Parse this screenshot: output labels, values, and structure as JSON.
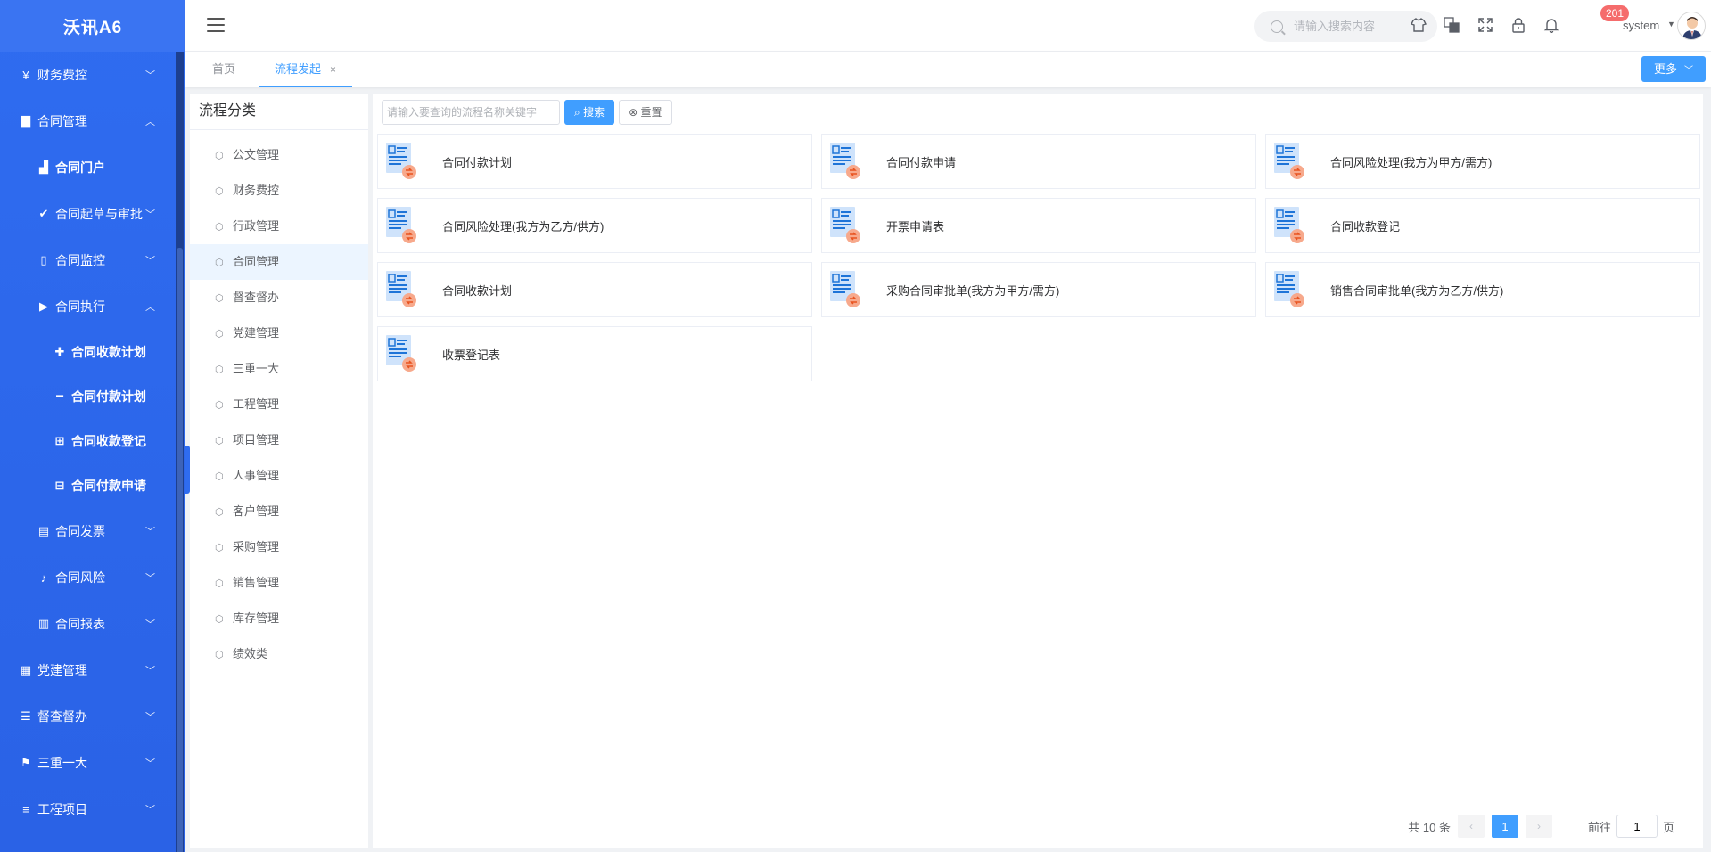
{
  "sidebar": {
    "brand": "沃讯A6",
    "items": [
      {
        "label": "财务费控",
        "icon": "yen-icon",
        "glyph": "¥"
      },
      {
        "label": "合同管理",
        "icon": "file-icon",
        "glyph": "▇"
      },
      {
        "label": "合同门户",
        "icon": "chart-icon",
        "glyph": "▟"
      },
      {
        "label": "合同起草与审批",
        "icon": "check-icon",
        "glyph": "✔"
      },
      {
        "label": "合同监控",
        "icon": "file-outline-icon",
        "glyph": "▯"
      },
      {
        "label": "合同执行",
        "icon": "play-icon",
        "glyph": "▶"
      },
      {
        "label": "合同收款计划",
        "icon": "plus-icon",
        "glyph": "✚"
      },
      {
        "label": "合同付款计划",
        "icon": "minus-icon",
        "glyph": "━"
      },
      {
        "label": "合同收款登记",
        "icon": "plus-square-icon",
        "glyph": "⊞"
      },
      {
        "label": "合同付款申请",
        "icon": "minus-square-icon",
        "glyph": "⊟"
      },
      {
        "label": "合同发票",
        "icon": "invoice-icon",
        "glyph": "▤"
      },
      {
        "label": "合同风险",
        "icon": "bell-icon",
        "glyph": "♪"
      },
      {
        "label": "合同报表",
        "icon": "bar-chart-icon",
        "glyph": "▥"
      },
      {
        "label": "党建管理",
        "icon": "bank-icon",
        "glyph": "▦"
      },
      {
        "label": "督查督办",
        "icon": "list-icon",
        "glyph": "☰"
      },
      {
        "label": "三重一大",
        "icon": "flag-icon",
        "glyph": "⚑"
      },
      {
        "label": "工程项目",
        "icon": "bars-icon",
        "glyph": "≡"
      }
    ]
  },
  "header": {
    "search_placeholder": "请输入搜索内容",
    "notification_count": "201",
    "username": "system"
  },
  "tabs": {
    "home": "首页",
    "current": "流程发起",
    "close": "×",
    "more": "更多"
  },
  "categories": {
    "title": "流程分类",
    "items": [
      "公文管理",
      "财务费控",
      "行政管理",
      "合同管理",
      "督查督办",
      "党建管理",
      "三重一大",
      "工程管理",
      "项目管理",
      "人事管理",
      "客户管理",
      "采购管理",
      "销售管理",
      "库存管理",
      "绩效类"
    ],
    "active": "合同管理"
  },
  "toolbar": {
    "placeholder": "请输入要查询的流程名称关键字",
    "search_label": "搜索",
    "reset_label": "重置"
  },
  "flows": [
    "合同付款计划",
    "合同付款申请",
    "合同风险处理(我方为甲方/需方)",
    "合同风险处理(我方为乙方/供方)",
    "开票申请表",
    "合同收款登记",
    "合同收款计划",
    "采购合同审批单(我方为甲方/需方)",
    "销售合同审批单(我方为乙方/供方)",
    "收票登记表"
  ],
  "pagination": {
    "total_text": "共 10 条",
    "current_page": "1",
    "goto_label": "前往",
    "goto_value": "1",
    "page_suffix": "页"
  },
  "colors": {
    "primary": "#409eff",
    "sidebar": "#2f6cf0",
    "badge": "#f56c6c"
  }
}
